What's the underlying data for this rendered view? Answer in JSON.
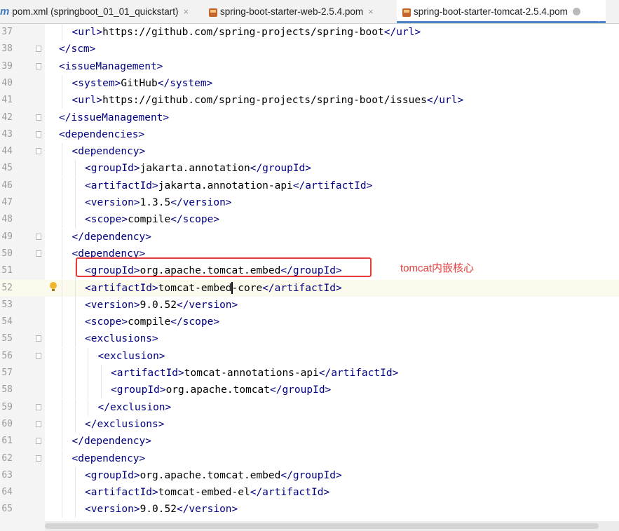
{
  "tabs": [
    {
      "label": "pom.xml (springboot_01_01_quickstart)",
      "icon": "maven-m-icon",
      "active": false
    },
    {
      "label": "spring-boot-starter-web-2.5.4.pom",
      "icon": "pom-file-icon",
      "active": false
    },
    {
      "label": "spring-boot-starter-tomcat-2.5.4.pom",
      "icon": "pom-file-icon",
      "active": true
    }
  ],
  "tab_close_glyph": "×",
  "maven_icon_glyph": "m",
  "editor": {
    "lines": [
      {
        "num": "37",
        "indent": 1,
        "tokens": [
          [
            "t",
            "<url>"
          ],
          [
            "x",
            "https://github.com/spring-projects/spring-boot"
          ],
          [
            "t",
            "</url>"
          ]
        ]
      },
      {
        "num": "38",
        "indent": 0,
        "tokens": [
          [
            "t",
            "</scm>"
          ]
        ]
      },
      {
        "num": "39",
        "indent": 0,
        "tokens": [
          [
            "t",
            "<issueManagement>"
          ]
        ]
      },
      {
        "num": "40",
        "indent": 1,
        "tokens": [
          [
            "t",
            "<system>"
          ],
          [
            "x",
            "GitHub"
          ],
          [
            "t",
            "</system>"
          ]
        ]
      },
      {
        "num": "41",
        "indent": 1,
        "tokens": [
          [
            "t",
            "<url>"
          ],
          [
            "x",
            "https://github.com/spring-projects/spring-boot/issues"
          ],
          [
            "t",
            "</url>"
          ]
        ]
      },
      {
        "num": "42",
        "indent": 0,
        "tokens": [
          [
            "t",
            "</issueManagement>"
          ]
        ]
      },
      {
        "num": "43",
        "indent": 0,
        "tokens": [
          [
            "t",
            "<dependencies>"
          ]
        ]
      },
      {
        "num": "44",
        "indent": 1,
        "tokens": [
          [
            "t",
            "<dependency>"
          ]
        ]
      },
      {
        "num": "45",
        "indent": 2,
        "tokens": [
          [
            "t",
            "<groupId>"
          ],
          [
            "x",
            "jakarta.annotation"
          ],
          [
            "t",
            "</groupId>"
          ]
        ]
      },
      {
        "num": "46",
        "indent": 2,
        "tokens": [
          [
            "t",
            "<artifactId>"
          ],
          [
            "x",
            "jakarta.annotation-api"
          ],
          [
            "t",
            "</artifactId>"
          ]
        ]
      },
      {
        "num": "47",
        "indent": 2,
        "tokens": [
          [
            "t",
            "<version>"
          ],
          [
            "x",
            "1.3.5"
          ],
          [
            "t",
            "</version>"
          ]
        ]
      },
      {
        "num": "48",
        "indent": 2,
        "tokens": [
          [
            "t",
            "<scope>"
          ],
          [
            "x",
            "compile"
          ],
          [
            "t",
            "</scope>"
          ]
        ]
      },
      {
        "num": "49",
        "indent": 1,
        "tokens": [
          [
            "t",
            "</dependency>"
          ]
        ]
      },
      {
        "num": "50",
        "indent": 1,
        "tokens": [
          [
            "t",
            "<dependency>"
          ]
        ]
      },
      {
        "num": "51",
        "indent": 2,
        "tokens": [
          [
            "t",
            "<groupId>"
          ],
          [
            "x",
            "org.apache.tomcat.embed"
          ],
          [
            "t",
            "</groupId>"
          ]
        ]
      },
      {
        "num": "52",
        "indent": 2,
        "tokens": [
          [
            "t",
            "<artifactId>"
          ],
          [
            "x",
            "tomcat-embed"
          ],
          [
            "c",
            ""
          ],
          [
            "x",
            "-core"
          ],
          [
            "t",
            "</artifactId>"
          ]
        ],
        "current": true
      },
      {
        "num": "53",
        "indent": 2,
        "tokens": [
          [
            "t",
            "<version>"
          ],
          [
            "x",
            "9.0.52"
          ],
          [
            "t",
            "</version>"
          ]
        ]
      },
      {
        "num": "54",
        "indent": 2,
        "tokens": [
          [
            "t",
            "<scope>"
          ],
          [
            "x",
            "compile"
          ],
          [
            "t",
            "</scope>"
          ]
        ]
      },
      {
        "num": "55",
        "indent": 2,
        "tokens": [
          [
            "t",
            "<exclusions>"
          ]
        ]
      },
      {
        "num": "56",
        "indent": 3,
        "tokens": [
          [
            "t",
            "<exclusion>"
          ]
        ]
      },
      {
        "num": "57",
        "indent": 4,
        "tokens": [
          [
            "t",
            "<artifactId>"
          ],
          [
            "x",
            "tomcat-annotations-api"
          ],
          [
            "t",
            "</artifactId>"
          ]
        ]
      },
      {
        "num": "58",
        "indent": 4,
        "tokens": [
          [
            "t",
            "<groupId>"
          ],
          [
            "x",
            "org.apache.tomcat"
          ],
          [
            "t",
            "</groupId>"
          ]
        ]
      },
      {
        "num": "59",
        "indent": 3,
        "tokens": [
          [
            "t",
            "</exclusion>"
          ]
        ]
      },
      {
        "num": "60",
        "indent": 2,
        "tokens": [
          [
            "t",
            "</exclusions>"
          ]
        ]
      },
      {
        "num": "61",
        "indent": 1,
        "tokens": [
          [
            "t",
            "</dependency>"
          ]
        ]
      },
      {
        "num": "62",
        "indent": 1,
        "tokens": [
          [
            "t",
            "<dependency>"
          ]
        ]
      },
      {
        "num": "63",
        "indent": 2,
        "tokens": [
          [
            "t",
            "<groupId>"
          ],
          [
            "x",
            "org.apache.tomcat.embed"
          ],
          [
            "t",
            "</groupId>"
          ]
        ]
      },
      {
        "num": "64",
        "indent": 2,
        "tokens": [
          [
            "t",
            "<artifactId>"
          ],
          [
            "x",
            "tomcat-embed-el"
          ],
          [
            "t",
            "</artifactId>"
          ]
        ]
      },
      {
        "num": "65",
        "indent": 2,
        "tokens": [
          [
            "t",
            "<version>"
          ],
          [
            "x",
            "9.0.52"
          ],
          [
            "t",
            "</version>"
          ]
        ]
      }
    ]
  },
  "annotation": {
    "text": "tomcat内嵌核心",
    "color": "#e53b3b"
  },
  "colors": {
    "tag": "#000080",
    "text": "#000000",
    "line_number": "#9a9a9a",
    "current_line": "#fcfaed",
    "annotation_box": "#e53b3b"
  }
}
